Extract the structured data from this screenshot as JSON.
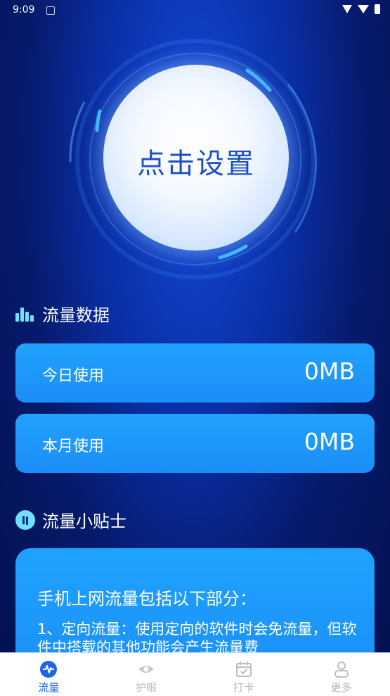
{
  "status_bar": {
    "time": "9:09"
  },
  "hero": {
    "button_label": "点击设置"
  },
  "traffic_section": {
    "title": "流量数据",
    "cards": [
      {
        "label": "今日使用",
        "value": "0MB"
      },
      {
        "label": "本月使用",
        "value": "0MB"
      }
    ]
  },
  "tips_section": {
    "title": "流量小贴士",
    "heading": "手机上网流量包括以下部分：",
    "body": "1、定向流量：使用定向的软件时会免流量，但软件中搭载的其他功能会产生流量费"
  },
  "bottom_nav": {
    "items": [
      {
        "label": "流量",
        "icon": "pulse-icon",
        "active": true
      },
      {
        "label": "护眼",
        "icon": "eye-icon",
        "active": false
      },
      {
        "label": "打卡",
        "icon": "calendar-check-icon",
        "active": false
      },
      {
        "label": "更多",
        "icon": "user-icon",
        "active": false
      }
    ]
  },
  "colors": {
    "accent": "#1d66e8",
    "card": "#1b8df7",
    "highlight": "#6fe0ff"
  }
}
